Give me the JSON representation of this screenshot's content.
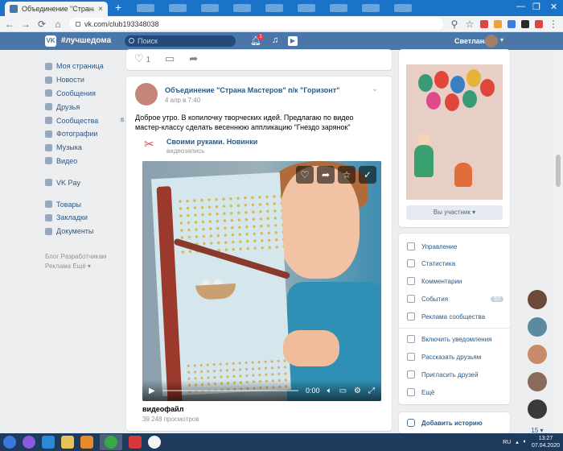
{
  "browser": {
    "tab_title": "Объединение \"Страна Мастеров\"",
    "tab_close": "×",
    "new_tab": "+",
    "url": "vk.com/club193348038",
    "minimize": "—",
    "maximize": "❐",
    "close": "✕"
  },
  "header": {
    "logo": "VK",
    "tag": "#лучшедома",
    "search_placeholder": "Поиск",
    "notifications_count": "1",
    "user_name": "Светлана",
    "caret": "▾"
  },
  "sidebar": {
    "items": [
      {
        "label": "Моя страница",
        "color": "#5b88bd"
      },
      {
        "label": "Новости",
        "color": "#5b88bd"
      },
      {
        "label": "Сообщения",
        "color": "#5b88bd"
      },
      {
        "label": "Друзья",
        "color": "#5b88bd"
      },
      {
        "label": "Сообщества",
        "color": "#5b88bd",
        "count": "6"
      },
      {
        "label": "Фотографии",
        "color": "#5b88bd"
      },
      {
        "label": "Музыка",
        "color": "#5b88bd"
      },
      {
        "label": "Видео",
        "color": "#5b88bd"
      }
    ],
    "pay": {
      "label": "VK Pay"
    },
    "extra": [
      {
        "label": "Товары"
      },
      {
        "label": "Закладки"
      },
      {
        "label": "Документы"
      }
    ],
    "footer_line1": "Блог   Разработчикам",
    "footer_line2": "Реклама   Ещё ▾"
  },
  "previous_post": {
    "likes": "1"
  },
  "post": {
    "author": "Объединение \"Страна Мастеров\" п/к \"Горизонт\"",
    "date": "4 апр в 7:40",
    "text": "Доброе утро. В копилочку творческих идей. Предлагаю по видео мастер-классу сделать весеннюю аппликацию \"Гнездо зарянок\"",
    "repost_author": "Своими руками. Новинки",
    "repost_type": "видеозапись",
    "video": {
      "time": "0:00",
      "progress": 0,
      "title": "видеофайл",
      "views": "39 248 просмотров"
    }
  },
  "right": {
    "member_button": "Вы участник ▾",
    "actions": [
      {
        "label": "Управление"
      },
      {
        "label": "Статистика"
      },
      {
        "label": "Комментарии"
      },
      {
        "label": "События",
        "badge": "52"
      },
      {
        "label": "Реклама сообщества"
      },
      {
        "label": "Включить уведомления"
      },
      {
        "label": "Рассказать друзьям"
      },
      {
        "label": "Пригласить друзей"
      },
      {
        "label": "Ещё"
      }
    ],
    "story": "Добавить историю"
  },
  "chats": {
    "count": "15 ▾"
  },
  "taskbar": {
    "lang": "RU",
    "time": "13:27",
    "date": "07.04.2020"
  },
  "colors": {
    "vk_blue": "#4a76a8",
    "link": "#2a5885"
  }
}
